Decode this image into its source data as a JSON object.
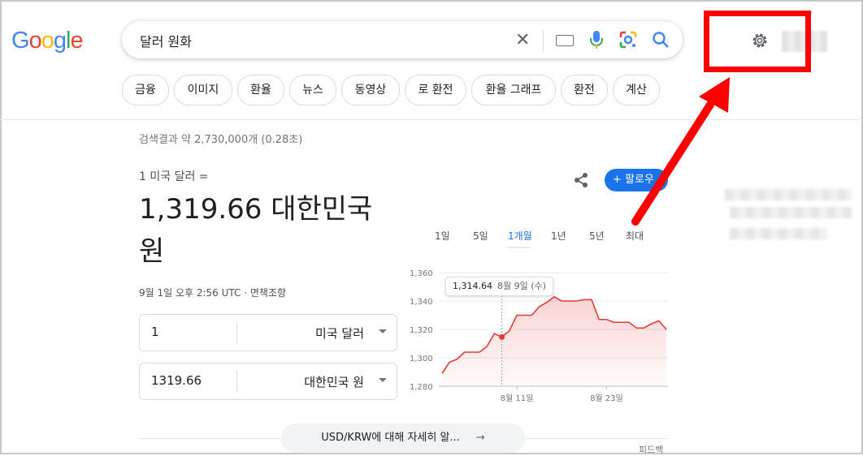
{
  "logo": {
    "letters": [
      "G",
      "o",
      "o",
      "g",
      "l",
      "e"
    ],
    "colors": [
      "#4285F4",
      "#EA4335",
      "#FBBC05",
      "#4285F4",
      "#34A853",
      "#EA4335"
    ]
  },
  "search": {
    "query": "달러 원화"
  },
  "chips": [
    "금융",
    "이미지",
    "환율",
    "뉴스",
    "동영상",
    "로 환전",
    "환율 그래프",
    "환전",
    "계산"
  ],
  "result_stats": "검색결과 약 2,730,000개 (0.28초)",
  "converter": {
    "from_label": "1 미국 달러 =",
    "rate": "1,319.66 대한민국 원",
    "timestamp": "9월 1일 오후 2:56 UTC · 면책조항",
    "from_amount": "1",
    "from_currency": "미국 달러",
    "to_amount": "1319.66",
    "to_currency": "대한민국 원"
  },
  "follow_label": "+ 팔로우",
  "range_tabs": [
    "1일",
    "5일",
    "1개월",
    "1년",
    "5년",
    "최대"
  ],
  "active_range": "1개월",
  "tooltip": {
    "value": "1,314.64",
    "date": "8월 9일 (수)"
  },
  "more_button": "USD/KRW에 대해 자세히 알...",
  "feedback": "피드백",
  "colors": {
    "accent": "#1a73e8",
    "line": "#e53935",
    "annotation": "#ff0000"
  },
  "chart_data": {
    "type": "area",
    "y_ticks": [
      "1,360",
      "1,340",
      "1,320",
      "1,300",
      "1,280"
    ],
    "x_ticks": [
      "8월 11일",
      "8월 23일"
    ],
    "ylim": [
      1280,
      1360
    ],
    "values": [
      1289,
      1297,
      1299,
      1304,
      1304,
      1304,
      1308,
      1317,
      1314.64,
      1319,
      1330,
      1330,
      1330,
      1336,
      1339,
      1343,
      1340,
      1340,
      1340,
      1341,
      1341,
      1327,
      1327,
      1325,
      1325,
      1325,
      1321,
      1321,
      1324,
      1326,
      1320
    ],
    "highlight_index": 8,
    "grid": true
  }
}
